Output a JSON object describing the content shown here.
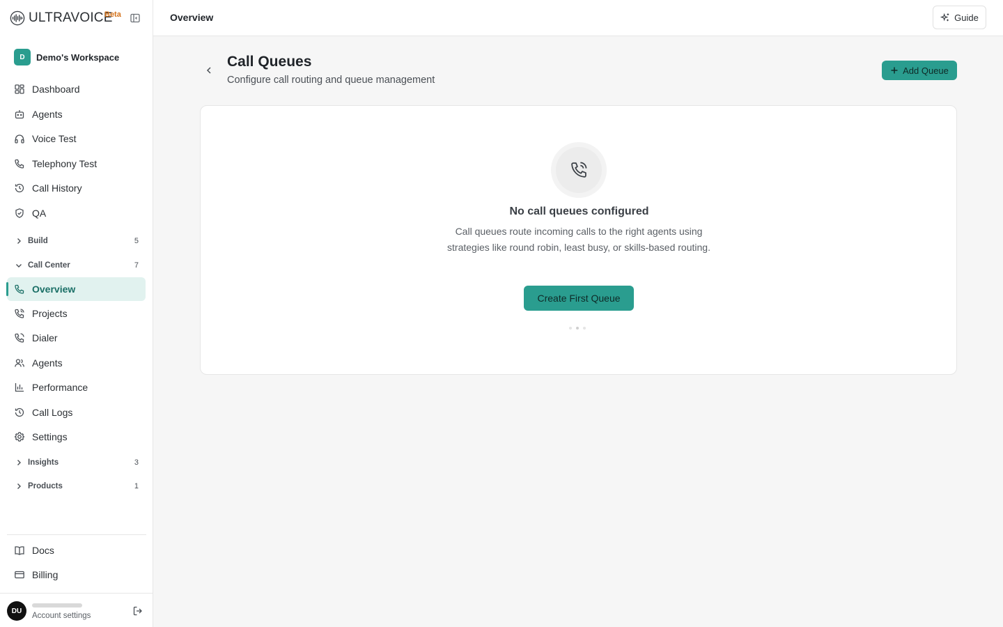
{
  "brand": {
    "name": "ULTRAVOICE",
    "badge": "Beta"
  },
  "workspace": {
    "initial": "D",
    "name": "Demo's Workspace"
  },
  "sidebar": {
    "top_items": [
      {
        "label": "Dashboard",
        "icon": "dashboard-icon"
      },
      {
        "label": "Agents",
        "icon": "bot-icon"
      },
      {
        "label": "Voice Test",
        "icon": "headphones-icon"
      },
      {
        "label": "Telephony Test",
        "icon": "phone-icon"
      },
      {
        "label": "Call History",
        "icon": "history-icon"
      },
      {
        "label": "QA",
        "icon": "shield-check-icon"
      }
    ],
    "groups": [
      {
        "label": "Build",
        "count": "5",
        "expanded": false
      },
      {
        "label": "Call Center",
        "count": "7",
        "expanded": true
      },
      {
        "label": "Insights",
        "count": "3",
        "expanded": false
      },
      {
        "label": "Products",
        "count": "1",
        "expanded": false
      }
    ],
    "call_center_items": [
      {
        "label": "Overview",
        "icon": "phone-icon",
        "active": true
      },
      {
        "label": "Projects",
        "icon": "phone-call-icon"
      },
      {
        "label": "Dialer",
        "icon": "phone-outgoing-icon"
      },
      {
        "label": "Agents",
        "icon": "users-icon"
      },
      {
        "label": "Performance",
        "icon": "bar-chart-icon"
      },
      {
        "label": "Call Logs",
        "icon": "history-icon"
      },
      {
        "label": "Settings",
        "icon": "gear-icon"
      }
    ],
    "bottom_items": [
      {
        "label": "Docs",
        "icon": "book-icon"
      },
      {
        "label": "Billing",
        "icon": "credit-card-icon"
      }
    ],
    "account": {
      "initials": "DU",
      "label": "Account settings"
    }
  },
  "topbar": {
    "breadcrumb": "Overview",
    "guide_label": "Guide"
  },
  "page": {
    "title": "Call Queues",
    "subtitle": "Configure call routing and queue management",
    "add_button": "Add Queue"
  },
  "empty_state": {
    "title": "No call queues configured",
    "description": "Call queues route incoming calls to the right agents using strategies like round robin, least busy, or skills-based routing.",
    "cta": "Create First Queue"
  },
  "colors": {
    "accent": "#2a9d8f",
    "active_bg": "#e1f2ef",
    "beta": "#d4721a"
  }
}
